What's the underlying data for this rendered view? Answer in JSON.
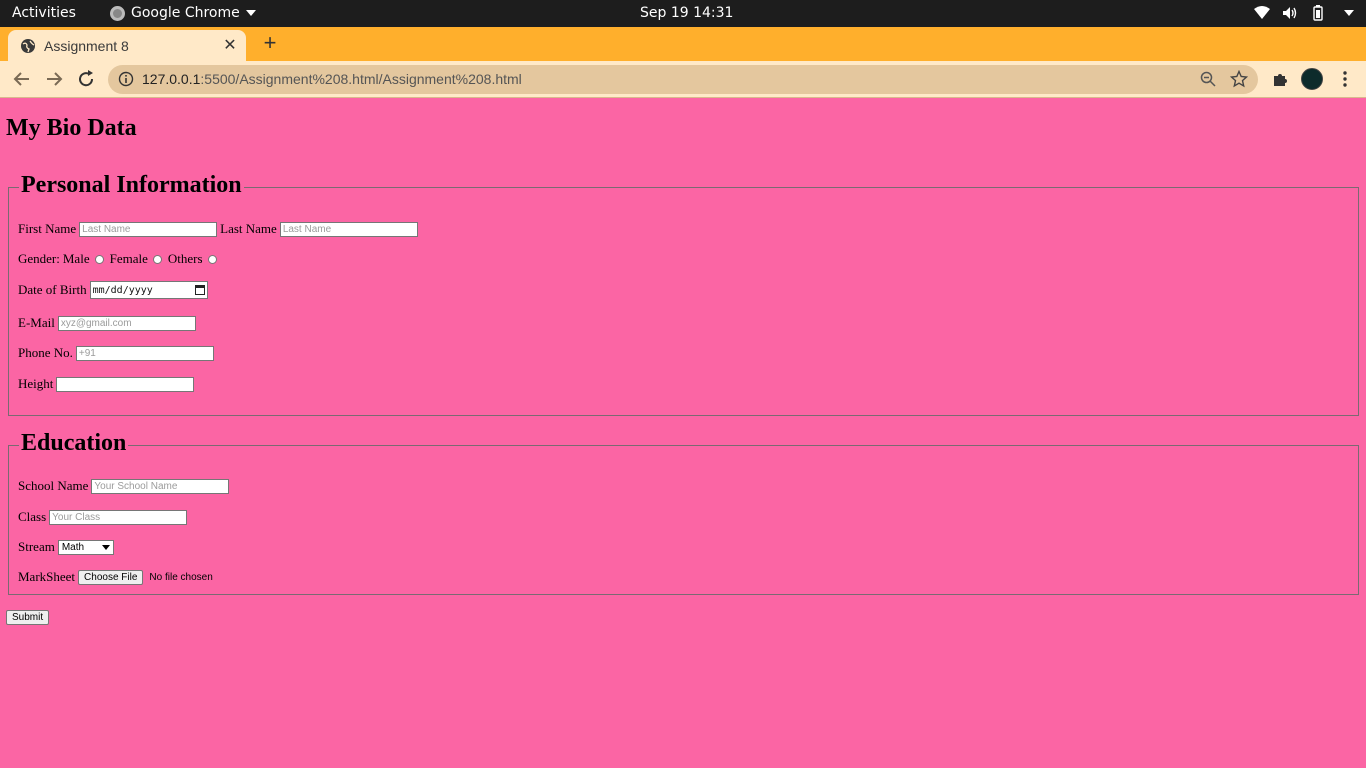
{
  "os": {
    "activities": "Activities",
    "app_name": "Google Chrome",
    "clock": "Sep 19  14:31"
  },
  "browser": {
    "tab_title": "Assignment 8",
    "new_tab": "+",
    "url_host": "127.0.0.1",
    "url_path": ":5500/Assignment%208.html/Assignment%208.html",
    "tab_strip_color": "#ffaf2c",
    "toolbar_color": "#ffe9c8"
  },
  "page": {
    "background": "#fb65a4",
    "heading": "My Bio Data",
    "personal": {
      "legend": "Personal Information",
      "first_name_label": "First Name",
      "first_name_placeholder": "Last Name",
      "last_name_label": "Last Name",
      "last_name_placeholder": "Last Name",
      "gender_label": "Gender:",
      "gender_options": [
        "Male",
        "Female",
        "Others"
      ],
      "dob_label": "Date of Birth",
      "dob_value": "mm/dd/yyyy",
      "email_label": "E-Mail",
      "email_placeholder": "xyz@gmail.com",
      "phone_label": "Phone No.",
      "phone_placeholder": "+91",
      "height_label": "Height",
      "height_value": ""
    },
    "education": {
      "legend": "Education",
      "school_label": "School Name",
      "school_placeholder": "Your School Name",
      "class_label": "Class",
      "class_placeholder": "Your Class",
      "stream_label": "Stream",
      "stream_value": "Math",
      "marksheet_label": "MarkSheet",
      "file_button": "Choose File",
      "file_status": "No file chosen"
    },
    "submit": "Submit"
  }
}
